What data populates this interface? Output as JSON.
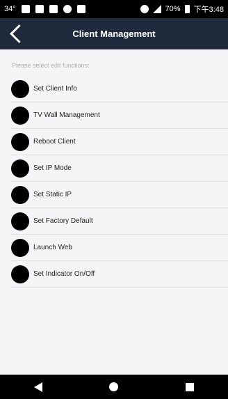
{
  "status_bar": {
    "temperature": "34°",
    "battery_percent": "70%",
    "time": "下午3:48",
    "icons": [
      "cloud-icon",
      "gallery-icon",
      "image-icon",
      "settings-icon",
      "notification-icon",
      "wifi-icon",
      "signal-icon",
      "battery-icon"
    ]
  },
  "header": {
    "title": "Client Management",
    "back_icon": "chevron-left-icon"
  },
  "main": {
    "instruction": "Please select edit functions:",
    "items": [
      {
        "label": "Set Client Info"
      },
      {
        "label": "TV Wall Management"
      },
      {
        "label": "Reboot Client"
      },
      {
        "label": "Set IP Mode"
      },
      {
        "label": "Set Static IP"
      },
      {
        "label": "Set Factory Default"
      },
      {
        "label": "Launch Web"
      },
      {
        "label": "Set Indicator On/Off"
      }
    ]
  },
  "nav_bar": {
    "icons": [
      "back-icon",
      "home-icon",
      "recent-apps-icon"
    ]
  },
  "colors": {
    "header_bg": "#1f2b3c",
    "main_bg": "#f5f5f7",
    "divider": "#e3e3e6"
  }
}
